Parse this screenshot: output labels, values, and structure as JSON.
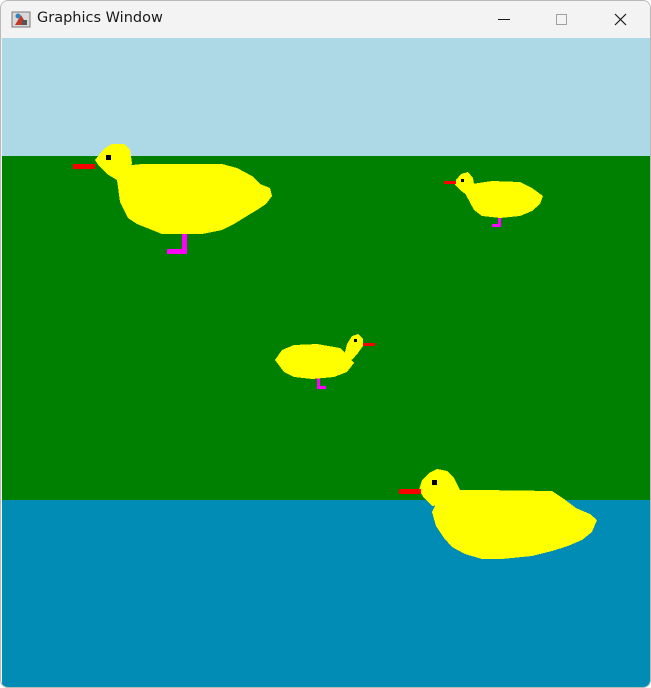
{
  "window": {
    "title": "Graphics Window",
    "controls": {
      "minimize_icon": "minimize-icon",
      "maximize_icon": "maximize-icon",
      "close_icon": "close-icon"
    }
  },
  "scene": {
    "colors": {
      "sky": "#add8e6",
      "grass": "#008000",
      "water": "#008cb4",
      "duck_body": "#ffff00",
      "beak": "#ff0000",
      "legs": "#ff00ff",
      "eye": "#000000"
    },
    "ducks": [
      {
        "name": "large-duck-top-left",
        "facing": "left",
        "legs": true
      },
      {
        "name": "small-duck-top-right",
        "facing": "left",
        "legs": true
      },
      {
        "name": "small-duck-center",
        "facing": "right",
        "legs": true
      },
      {
        "name": "large-duck-swimming",
        "facing": "left",
        "legs": false
      }
    ]
  }
}
